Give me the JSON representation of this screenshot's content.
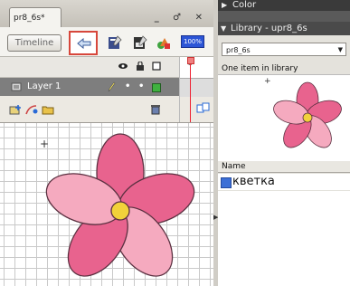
{
  "document": {
    "tab_title": "pr8_6s*",
    "window_buttons": "_ ♂ ✕",
    "toolbar": {
      "timeline_label": "Timeline",
      "zoom_label": "100%"
    },
    "timeline": {
      "frame_number": "5",
      "layer_name": "Layer 1"
    }
  },
  "panel": {
    "color_title": "Color",
    "library_title": "Library - upr8_6s",
    "library_select_value": "pr8_6s",
    "library_count": "One item in library",
    "column_name": "Name",
    "items": [
      {
        "name": "кветка"
      }
    ]
  },
  "colors": {
    "petal_dark": "#e8638e",
    "petal_light": "#f5aabf",
    "center": "#f2d23a",
    "highlight": "#d7473b"
  }
}
